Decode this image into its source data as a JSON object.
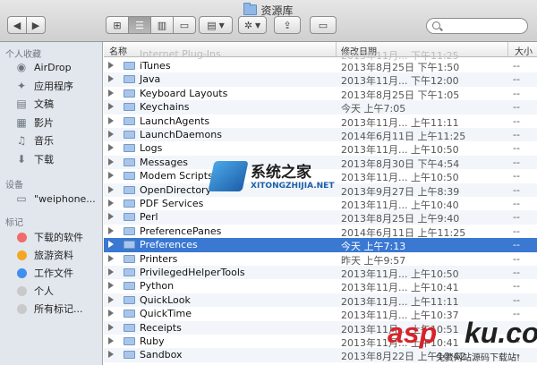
{
  "window": {
    "title": "资源库"
  },
  "toolbar": {
    "back_label": "◀",
    "forward_label": "▶",
    "view_icons": "⊞",
    "view_list": "☰",
    "view_columns": "▥",
    "view_coverflow": "▭",
    "arrange_label": "▤",
    "action_label": "✲",
    "share_label": "⇪",
    "tags_label": "▭",
    "search_placeholder": ""
  },
  "sidebar": {
    "favorites_heading": "个人收藏",
    "favorites": [
      {
        "label": "AirDrop",
        "icon": "airdrop-icon"
      },
      {
        "label": "应用程序",
        "icon": "applications-icon"
      },
      {
        "label": "文稿",
        "icon": "documents-icon"
      },
      {
        "label": "影片",
        "icon": "movies-icon"
      },
      {
        "label": "音乐",
        "icon": "music-icon"
      },
      {
        "label": "下载",
        "icon": "downloads-icon"
      }
    ],
    "devices_heading": "设备",
    "devices": [
      {
        "label": "\"weiphone...",
        "icon": "computer-icon"
      }
    ],
    "tags_heading": "标记",
    "tags": [
      {
        "label": "下载的软件",
        "color": "#f06b6b"
      },
      {
        "label": "旅游资料",
        "color": "#f5a623"
      },
      {
        "label": "工作文件",
        "color": "#3f8ef0"
      },
      {
        "label": "个人",
        "color": "#c9c9c9"
      },
      {
        "label": "所有标记...",
        "color": "#c9c9c9"
      }
    ]
  },
  "list": {
    "columns": {
      "name": "名称",
      "date": "修改日期",
      "size": "大小"
    },
    "ghost_name": "Internet Plug-Ins",
    "ghost_date": "2013年11月... 下午11:25",
    "rows": [
      {
        "name": "iTunes",
        "date": "2013年8月25日 下午1:50",
        "size": "--"
      },
      {
        "name": "Java",
        "date": "2013年11月... 下午12:00",
        "size": "--"
      },
      {
        "name": "Keyboard Layouts",
        "date": "2013年8月25日 下午1:05",
        "size": "--"
      },
      {
        "name": "Keychains",
        "date": "今天 上午7:05",
        "size": "--"
      },
      {
        "name": "LaunchAgents",
        "date": "2013年11月... 上午11:11",
        "size": "--"
      },
      {
        "name": "LaunchDaemons",
        "date": "2014年6月11日 上午11:25",
        "size": "--"
      },
      {
        "name": "Logs",
        "date": "2013年11月... 上午10:50",
        "size": "--"
      },
      {
        "name": "Messages",
        "date": "2013年8月30日 下午4:54",
        "size": "--"
      },
      {
        "name": "Modem Scripts",
        "date": "2013年11月... 上午10:50",
        "size": "--"
      },
      {
        "name": "OpenDirectory",
        "date": "2013年9月27日 上午8:39",
        "size": "--"
      },
      {
        "name": "PDF Services",
        "date": "2013年11月... 上午10:40",
        "size": "--"
      },
      {
        "name": "Perl",
        "date": "2013年8月25日 上午9:40",
        "size": "--"
      },
      {
        "name": "PreferencePanes",
        "date": "2014年6月11日 上午11:25",
        "size": "--"
      },
      {
        "name": "Preferences",
        "date": "今天 上午7:13",
        "size": "--"
      },
      {
        "name": "Printers",
        "date": "昨天 上午9:57",
        "size": "--"
      },
      {
        "name": "PrivilegedHelperTools",
        "date": "2013年11月... 上午10:50",
        "size": "--"
      },
      {
        "name": "Python",
        "date": "2013年11月... 上午10:41",
        "size": "--"
      },
      {
        "name": "QuickLook",
        "date": "2013年11月... 上午11:11",
        "size": "--"
      },
      {
        "name": "QuickTime",
        "date": "2013年11月... 上午10:37",
        "size": "--"
      },
      {
        "name": "Receipts",
        "date": "2013年11月... 上午10:51",
        "size": "--"
      },
      {
        "name": "Ruby",
        "date": "2013年11月... 上午10:41",
        "size": "--"
      },
      {
        "name": "Sandbox",
        "date": "2013年8月22日 上午10:42",
        "size": "--"
      }
    ],
    "selected_index": 13
  },
  "watermarks": {
    "site1_cn": "系统之家",
    "site1_en": "XITONGZHIJIA.NET",
    "site2_a": "asp",
    "site2_b": "ku.com",
    "site2_sub": "免费网站源码下载站!"
  }
}
